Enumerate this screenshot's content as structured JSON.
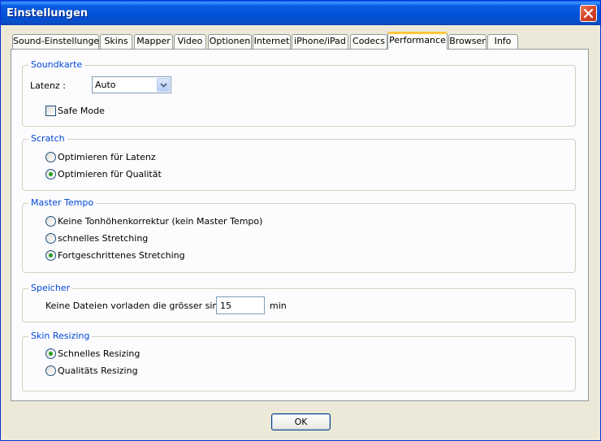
{
  "window": {
    "title": "Einstellungen"
  },
  "tabs": [
    {
      "label": "Sound-Einstellungen"
    },
    {
      "label": "Skins"
    },
    {
      "label": "Mapper"
    },
    {
      "label": "Video"
    },
    {
      "label": "Optionen"
    },
    {
      "label": "Internet"
    },
    {
      "label": "iPhone/iPad"
    },
    {
      "label": "Codecs"
    },
    {
      "label": "Performance",
      "active": true
    },
    {
      "label": "Browser"
    },
    {
      "label": "Info"
    }
  ],
  "soundkarte": {
    "title": "Soundkarte",
    "latenz_label": "Latenz :",
    "latenz_value": "Auto",
    "safe_mode_label": "Safe Mode",
    "safe_mode_checked": false
  },
  "scratch": {
    "title": "Scratch",
    "options": [
      {
        "label": "Optimieren für Latenz",
        "selected": false
      },
      {
        "label": "Optimieren für Qualität",
        "selected": true
      }
    ]
  },
  "master_tempo": {
    "title": "Master Tempo",
    "options": [
      {
        "label": "Keine Tonhöhenkorrektur (kein Master Tempo)",
        "selected": false
      },
      {
        "label": "schnelles Stretching",
        "selected": false
      },
      {
        "label": "Fortgeschrittenes Stretching",
        "selected": true
      }
    ]
  },
  "speicher": {
    "title": "Speicher",
    "label": "Keine Dateien vorladen die grösser sind als:",
    "value": "15",
    "unit": "min"
  },
  "skin_resizing": {
    "title": "Skin Resizing",
    "options": [
      {
        "label": "Schnelles Resizing",
        "selected": true
      },
      {
        "label": "Qualitäts Resizing",
        "selected": false
      }
    ]
  },
  "buttons": {
    "ok": "OK"
  }
}
